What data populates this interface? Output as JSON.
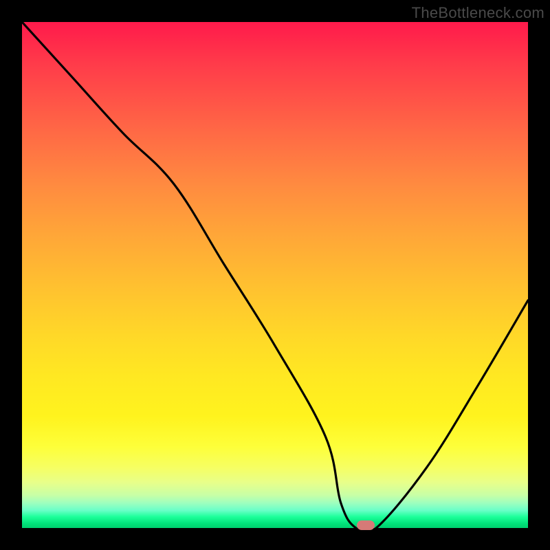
{
  "watermark": "TheBottleneck.com",
  "chart_data": {
    "type": "line",
    "title": "",
    "xlabel": "",
    "ylabel": "",
    "xlim": [
      0,
      100
    ],
    "ylim": [
      0,
      100
    ],
    "x": [
      0,
      10,
      20,
      30,
      40,
      50,
      60,
      63,
      66,
      70,
      80,
      90,
      100
    ],
    "values": [
      100,
      89,
      78,
      68,
      52,
      36,
      18,
      5,
      0,
      0,
      12,
      28,
      45
    ],
    "minimum_marker": {
      "x": 68,
      "y": 0
    },
    "background_gradient": {
      "top": "#ff1a4b",
      "mid1": "#ffa638",
      "mid2": "#fff31e",
      "bottom": "#00d070"
    },
    "curve_color": "#000000",
    "marker_color": "#d67a77"
  }
}
